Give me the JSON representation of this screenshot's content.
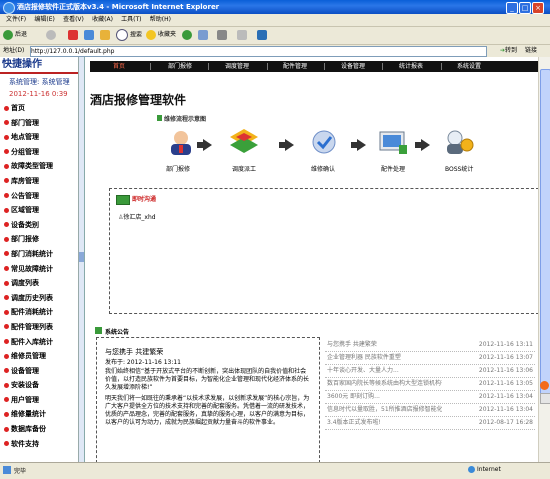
{
  "browser": {
    "title": "酒店报修软件正式版本v3.4 - Microsoft Internet Explorer",
    "menu": [
      "文件(F)",
      "编辑(E)",
      "查看(V)",
      "收藏(A)",
      "工具(T)",
      "帮助(H)"
    ],
    "toolbar": {
      "back": "后退",
      "search": "搜索",
      "favorites": "收藏夹"
    },
    "address_label": "地址(D)",
    "address_value": "http://127.0.0.1/default.php",
    "go_label": "转到",
    "links_label": "链接",
    "status": "完毕",
    "zone": "Internet"
  },
  "sidebar": {
    "header": "快捷操作",
    "system": "系统管理: 系统管理",
    "datetime": "2012-11-16 0:39",
    "items": [
      "首页",
      "部门管理",
      "地点管理",
      "分组管理",
      "故障类型管理",
      "库房管理",
      "公告管理",
      "区域管理",
      "设备类别",
      "部门报修",
      "部门消耗统计",
      "常见故障统计",
      "调度列表",
      "调度历史列表",
      "配件消耗统计",
      "配件管理列表",
      "配件入库统计",
      "维修员管理",
      "设备管理",
      "安装设备",
      "用户管理",
      "维修量统计",
      "数据库备份",
      "软件支持"
    ]
  },
  "nav": [
    "首页",
    "部门报修",
    "调度管理",
    "配件管理",
    "设备管理",
    "统计报表",
    "系统设置"
  ],
  "page_title": "酒店报修管理软件",
  "flow": {
    "title": "维修流程示意图",
    "steps": [
      "部门报修",
      "调度派工",
      "维修确认",
      "配件处理",
      "BOSS统计"
    ]
  },
  "im": {
    "title": "即时沟通",
    "user": "徐汇店_xhd"
  },
  "announcement": {
    "header": "系统公告",
    "title": "与您携手 共建繁荣",
    "date": "发布于: 2012-11-16 13:11",
    "body1": "我们始终相信“基于开放式平台的不断创新，突出体现团队的自我价值和社会价值，以打造民族软件为首要目标，为智能化企业管理和现代化经济体系的长久发展增添阶梯!”",
    "body2": "明天我们将一如既往的秉承着“以技术求发展，以创新求发展”的核心宗旨，为广大客户提供全方位的技术支持和完善的配套服务。凭借着一流的研发技术，优质的产品理念，完善的配套服务，真挚的服务心理，以客户的满意为目标，以客户的认可为动力，成就为民族崛起贡献力量奋斗的软件事业。"
  },
  "news": [
    {
      "title": "与您携手 共建繁荣",
      "date": "2012-11-16 13:11"
    },
    {
      "title": "企业管理利器 民族软件重塑",
      "date": "2012-11-16 13:07"
    },
    {
      "title": "十年谈心开发、大量人力...",
      "date": "2012-11-16 13:06"
    },
    {
      "title": "数百家国内院长等候系统由构大型连锁机构有用见...",
      "date": "2012-11-16 13:05"
    },
    {
      "title": "3600元 即刻订购...",
      "date": "2012-11-16 13:04"
    },
    {
      "title": "信息时代以量取胜，51所推酒店报修智能化...",
      "date": "2012-11-16 13:04"
    },
    {
      "title": "3.4版本正式发布啦!",
      "date": "2012-08-17 16:28"
    }
  ]
}
